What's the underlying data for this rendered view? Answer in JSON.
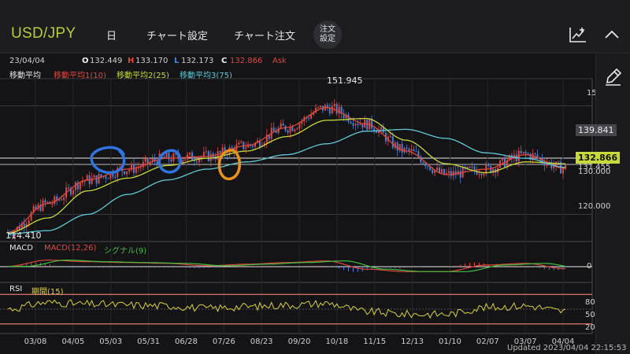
{
  "header": {
    "pair": "USD/JPY",
    "tabs": [
      "日",
      "チャート設定",
      "チャート注文"
    ],
    "order_button_line1": "注文",
    "order_button_line2": "設定"
  },
  "ohlc": {
    "date": "23/04/04",
    "open_label": "O",
    "open": "132.449",
    "high_label": "H",
    "high": "133.170",
    "low_label": "L",
    "low": "132.173",
    "close_label": "C",
    "close": "132.866",
    "ask": "Ask"
  },
  "moving_average": {
    "title": "移動平均",
    "ma1": "移動平均1(10)",
    "ma2": "移動平均2(25)",
    "ma3": "移動平均3(75)"
  },
  "price_axis": {
    "high_marker": "151.945",
    "low_marker": "114.410",
    "tick_150": "15",
    "tick_120": "120.000",
    "box_ma3": "139.841",
    "box_current": "132.866",
    "overlap_1": "131.455",
    "overlap_2": "130.000"
  },
  "macd": {
    "title": "MACD",
    "line_label": "MACD(12,26)",
    "signal_label": "シグナル(9)",
    "zero_tick": "0"
  },
  "rsi": {
    "title": "RSI",
    "period_label": "期間(15)",
    "ticks": [
      "80",
      "50",
      "20"
    ]
  },
  "x_axis": {
    "labels": [
      "03/08",
      "04/05",
      "05/03",
      "05/31",
      "06/28",
      "07/26",
      "08/23",
      "09/20",
      "10/18",
      "11/15",
      "12/13",
      "01/10",
      "02/07",
      "03/07",
      "04/04"
    ]
  },
  "footer": {
    "updated": "Updated  2023/04/04 22:15:53"
  },
  "colors": {
    "pair": "#b8cc3a",
    "ma1": "#e0483f",
    "ma2": "#c8d93a",
    "ma3": "#5fc9d6",
    "signal": "#3fbf3f",
    "rsi_line": "#d9d13a",
    "rsi_band": "#e57474",
    "candle_up": "#e0483f",
    "candle_down": "#4d7fd8",
    "annotation_blue": "#2f74e0",
    "annotation_orange": "#e8921e"
  },
  "chart_data": {
    "type": "line",
    "title": "",
    "x": [
      "03/08",
      "04/05",
      "05/03",
      "05/31",
      "06/28",
      "07/26",
      "08/23",
      "09/20",
      "10/18",
      "11/15",
      "12/13",
      "01/10",
      "02/07",
      "03/07",
      "04/04"
    ],
    "series": [
      {
        "name": "移動平均1(10)",
        "values": [
          115.0,
          123.0,
          129.5,
          132.5,
          135.5,
          136.0,
          139.0,
          144.0,
          149.5,
          145.0,
          137.5,
          131.0,
          132.5,
          136.5,
          132.7
        ]
      },
      {
        "name": "移動平均2(25)",
        "values": [
          114.8,
          119.0,
          126.5,
          130.0,
          133.5,
          135.5,
          137.5,
          141.5,
          146.0,
          146.5,
          140.5,
          134.0,
          131.5,
          134.5,
          134.0
        ]
      },
      {
        "name": "移動平均3(75)",
        "values": [
          114.6,
          115.5,
          120.0,
          125.5,
          129.5,
          132.5,
          134.5,
          136.5,
          139.5,
          143.0,
          143.5,
          141.0,
          137.0,
          135.5,
          133.0
        ]
      }
    ],
    "ylim": [
      112.5,
      157.5
    ],
    "xlabel": "",
    "ylabel": ""
  }
}
